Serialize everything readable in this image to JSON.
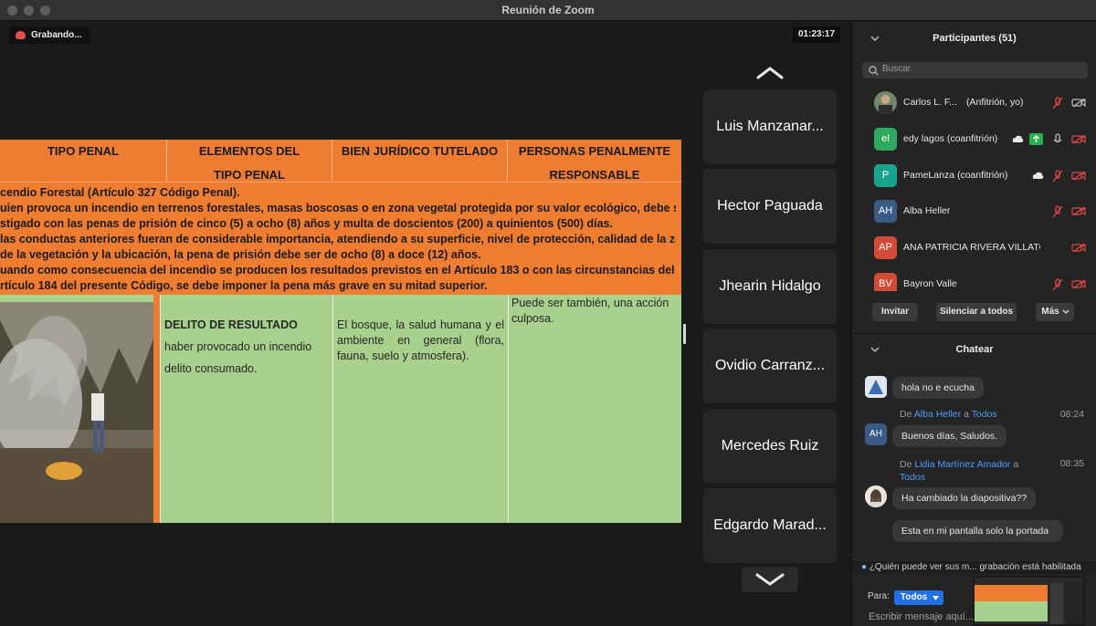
{
  "window": {
    "title": "Reunión de Zoom"
  },
  "meeting": {
    "recording_label": "Grabando...",
    "timer": "01:23:17"
  },
  "slide": {
    "headers": [
      {
        "line1": "TIPO PENAL",
        "line2": ""
      },
      {
        "line1": "ELEMENTOS DEL",
        "line2": "TIPO PENAL"
      },
      {
        "line1": "BIEN JURÍDICO TUTELADO",
        "line2": ""
      },
      {
        "line1": "PERSONAS PENALMENTE",
        "line2": "RESPONSABLE"
      }
    ],
    "orange_lines": [
      "cendio Forestal (Artículo 327 Código Penal).",
      "uien provoca un incendio en terrenos forestales, masas boscosas o en zona vegetal protegida por su valor ecológico, debe ser",
      "stigado con las penas de prisión de cinco (5) a ocho (8) años y multa de doscientos (200) a quinientos (500) días.",
      " las conductas anteriores fueran de considerable importancia, atendiendo a su superficie, nivel de protección, calidad de la zona",
      " de la vegetación y la ubicación, la pena de prisión debe ser de ocho (8) a doce (12) años.",
      "uando como consecuencia del incendio se producen los resultados previstos en el Artículo 183 o con las circunstancias del",
      "rtículo 184 del presente Código, se debe imponer la pena más grave en su mitad superior."
    ],
    "elements_title": "DELITO DE RESULTADO",
    "elements_line1": "haber provocado un incendio",
    "elements_line2": "delito consumado.",
    "bien_juridico": "El bosque, la salud humana y el ambiente en general (flora, fauna, suelo y atmosfera).",
    "responsables": "Puede ser también, una acción culposa."
  },
  "tiles": [
    "Luis Manzanar...",
    "Hector Paguada",
    "Jhearin Hidalgo",
    "Ovidio Carranz...",
    "Mercedes Ruiz",
    "Edgardo Marad..."
  ],
  "participants": {
    "title": "Participantes (51)",
    "search_placeholder": "Buscar",
    "list": [
      {
        "initials": "",
        "name": "Carlos L. F...",
        "role": "(Anfitrión, yo)",
        "color": "#7a6048"
      },
      {
        "initials": "el",
        "name": "edy lagos (coanfitrión)",
        "role": "",
        "color": "#2eaa5e"
      },
      {
        "initials": "P",
        "name": "PameLanza (coanfitrión)",
        "role": "",
        "color": "#17a38c"
      },
      {
        "initials": "AH",
        "name": "Alba Heller",
        "role": "",
        "color": "#3a5a86"
      },
      {
        "initials": "AP",
        "name": "ANA PATRICIA RIVERA VILLATOR...",
        "role": "",
        "color": "#d24a38"
      },
      {
        "initials": "BV",
        "name": "Bayron Valle",
        "role": "",
        "color": "#d24a38"
      }
    ],
    "invite": "Invitar",
    "mute_all": "Silenciar a todos",
    "more": "Más"
  },
  "chat": {
    "title": "Chatear",
    "messages": [
      {
        "from": "",
        "to": "",
        "time": "",
        "text": "hola no e ecucha"
      },
      {
        "from": "Alba Heller",
        "to": "Todos",
        "time": "08:24",
        "text": "Buenos días, Saludos."
      },
      {
        "from": "Lidia Martínez Amador",
        "to": "Todos",
        "time": "08:35",
        "text": "Ha cambiado la diapositiva??"
      },
      {
        "from": "",
        "to": "",
        "time": "",
        "text": "Esta en mi pantalla solo la portada"
      }
    ],
    "de": "De",
    "a": "a",
    "who_can_see": "¿Quién puede ver sus m... grabación está habilitada",
    "to_label": "Para:",
    "to_value": "Todos",
    "message_placeholder": "Escribir mensaje aquí..."
  },
  "colors": {
    "orange": "#ee7d32",
    "green": "#a9d18e",
    "accent": "#1f6fe5"
  }
}
